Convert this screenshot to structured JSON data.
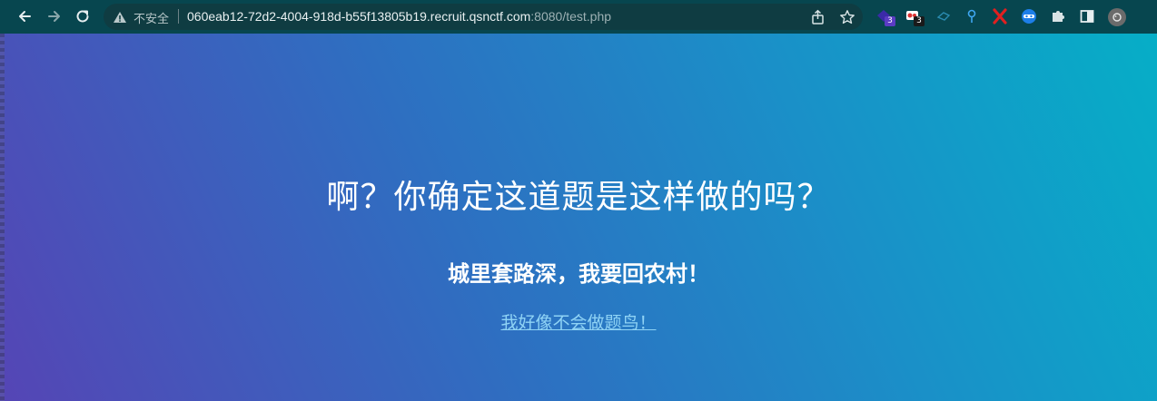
{
  "browser": {
    "security_label": "不安全",
    "url_main": "060eab12-72d2-4004-918d-b55f13805b19.recruit.qsnctf.com",
    "url_rest": ":8080/test.php",
    "extensions": [
      {
        "name": "ext-purple-gem",
        "badge": "3",
        "badge_color": "#5b3cc4"
      },
      {
        "name": "ext-red-white",
        "badge": "3",
        "badge_color": "#1a1a1a"
      }
    ],
    "colors": {
      "toolbar": "#07464f",
      "omnibox": "#0f3c42"
    }
  },
  "page": {
    "heading": "啊？你确定这道题是这样做的吗？",
    "subheading": "城里套路深，我要回农村！",
    "link_text": "我好像不会做题鸟！"
  }
}
